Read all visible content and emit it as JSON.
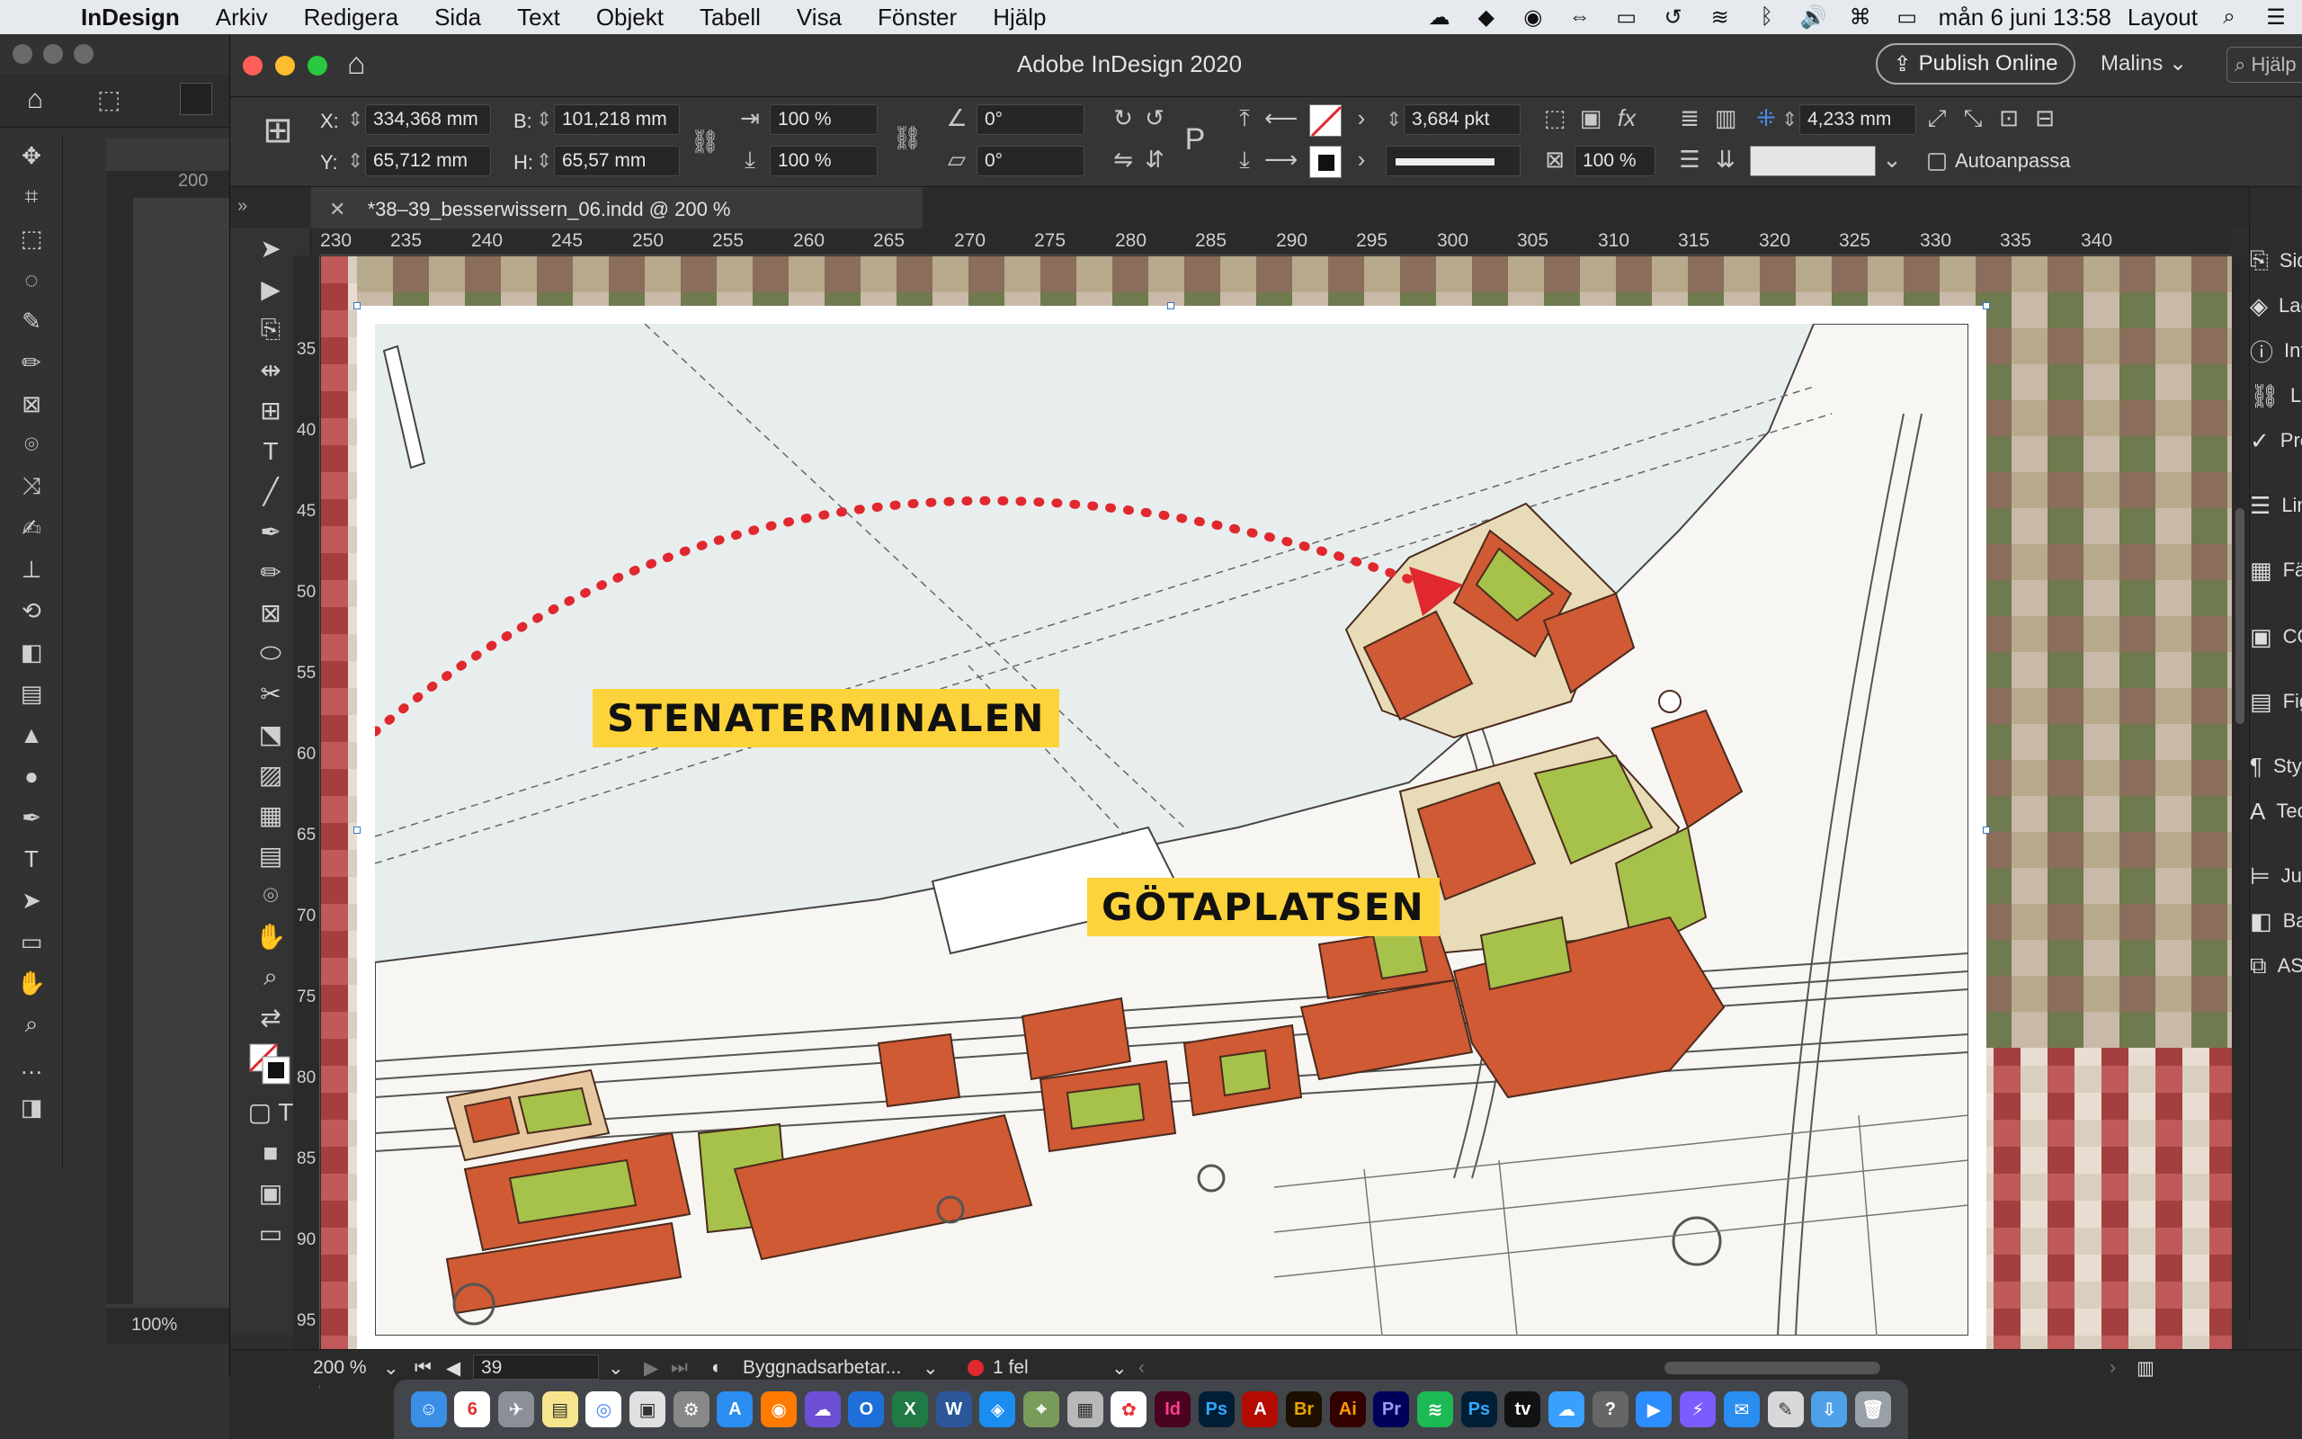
{
  "menubar": {
    "app": "InDesign",
    "items": [
      "Arkiv",
      "Redigera",
      "Sida",
      "Text",
      "Objekt",
      "Tabell",
      "Visa",
      "Fönster",
      "Hjälp"
    ],
    "clock": "mån 6 juni  13:58",
    "workspace_menu": "Layout"
  },
  "bgwin": {
    "ruler_tick": "200",
    "zoom": "100%"
  },
  "window": {
    "title": "Adobe InDesign 2020",
    "publish_label": "Publish Online",
    "workspace": "Malins",
    "search_placeholder": "Hjälp"
  },
  "control": {
    "x_label": "X:",
    "x_value": "334,368 mm",
    "y_label": "Y:",
    "y_value": "65,712 mm",
    "w_label": "B:",
    "w_value": "101,218 mm",
    "h_label": "H:",
    "h_value": "65,57 mm",
    "scale_x": "100 %",
    "scale_y": "100 %",
    "rotate": "0°",
    "shear": "0°",
    "stroke_weight": "3,684 pkt",
    "opacity": "100 %",
    "gap_value": "4,233 mm",
    "autofit_label": "Autoanpassa"
  },
  "doc_tab": {
    "title": "*38–39_besserwissern_06.indd @ 200 %"
  },
  "ruler": {
    "h_ticks": [
      "230",
      "235",
      "240",
      "245",
      "250",
      "255",
      "260",
      "265",
      "270",
      "275",
      "280",
      "285",
      "290",
      "295",
      "300",
      "305",
      "310",
      "315",
      "320",
      "325",
      "330",
      "335",
      "340"
    ],
    "v_ticks": [
      "35",
      "40",
      "45",
      "50",
      "55",
      "60",
      "65",
      "70",
      "75",
      "80",
      "85",
      "90",
      "95"
    ]
  },
  "map": {
    "label_1": "STENATERMINALEN",
    "label_2": "GÖTAPLATSEN",
    "arrow_color": "#e0282e",
    "label_color": "#fdd33b"
  },
  "right_panels": [
    "Sidor",
    "Lager",
    "Information",
    "Länkar",
    "Preflight",
    "Linje",
    "Färgrutor",
    "CC Libraries",
    "Figurer",
    "Styckeformat",
    "Teckenformat",
    "Justera",
    "Banhantering",
    "AS By"
  ],
  "statusbar": {
    "zoom": "200 %",
    "page": "39",
    "layer": "Byggnadsarbetar...",
    "errors": "1 fel"
  },
  "dock": {
    "calendar_day": "6",
    "app_badges": [
      "Id",
      "Ps",
      "Br",
      "Ai",
      "Pr",
      "Ps"
    ]
  }
}
